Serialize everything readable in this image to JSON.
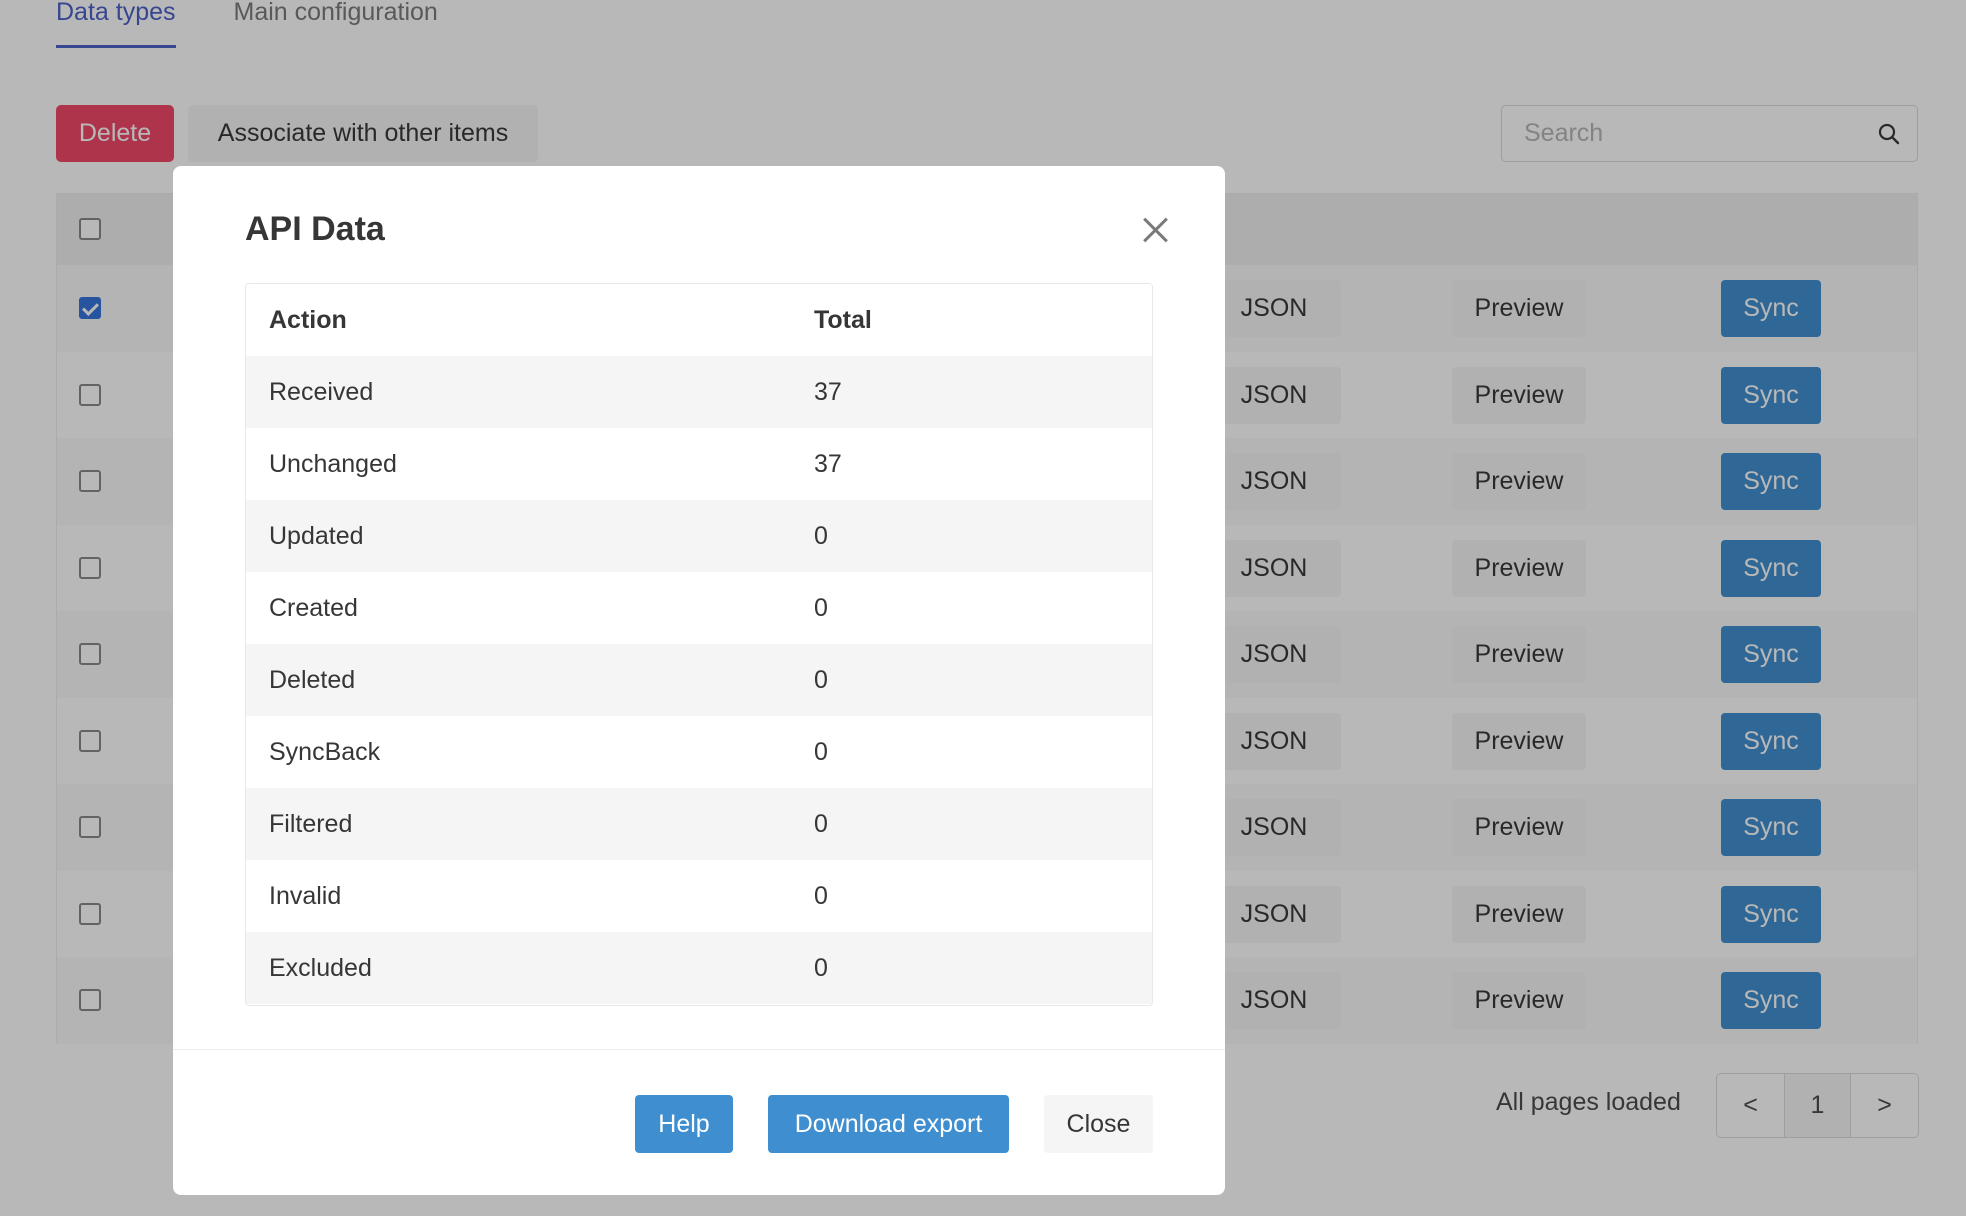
{
  "tabs": [
    {
      "label": "Data types",
      "active": true
    },
    {
      "label": "Main configuration",
      "active": false
    }
  ],
  "toolbar": {
    "delete_label": "Delete",
    "associate_label": "Associate with other items",
    "search_placeholder": "Search"
  },
  "table": {
    "rows": [
      {
        "checked": true,
        "json_label": "JSON",
        "preview_label": "Preview",
        "sync_label": "Sync"
      },
      {
        "checked": false,
        "json_label": "JSON",
        "preview_label": "Preview",
        "sync_label": "Sync"
      },
      {
        "checked": false,
        "json_label": "JSON",
        "preview_label": "Preview",
        "sync_label": "Sync"
      },
      {
        "checked": false,
        "json_label": "JSON",
        "preview_label": "Preview",
        "sync_label": "Sync"
      },
      {
        "checked": false,
        "json_label": "JSON",
        "preview_label": "Preview",
        "sync_label": "Sync"
      },
      {
        "checked": false,
        "json_label": "JSON",
        "preview_label": "Preview",
        "sync_label": "Sync"
      },
      {
        "checked": false,
        "json_label": "JSON",
        "preview_label": "Preview",
        "sync_label": "Sync"
      },
      {
        "checked": false,
        "json_label": "JSON",
        "preview_label": "Preview",
        "sync_label": "Sync"
      },
      {
        "checked": false,
        "json_label": "JSON",
        "preview_label": "Preview",
        "sync_label": "Sync"
      }
    ]
  },
  "footer": {
    "status": "All pages loaded",
    "prev_label": "<",
    "page": "1",
    "next_label": ">"
  },
  "modal": {
    "title": "API Data",
    "columns": [
      "Action",
      "Total"
    ],
    "rows": [
      {
        "action": "Received",
        "total": "37"
      },
      {
        "action": "Unchanged",
        "total": "37"
      },
      {
        "action": "Updated",
        "total": "0"
      },
      {
        "action": "Created",
        "total": "0"
      },
      {
        "action": "Deleted",
        "total": "0"
      },
      {
        "action": "SyncBack",
        "total": "0"
      },
      {
        "action": "Filtered",
        "total": "0"
      },
      {
        "action": "Invalid",
        "total": "0"
      },
      {
        "action": "Excluded",
        "total": "0"
      }
    ],
    "help_label": "Help",
    "download_label": "Download export",
    "close_label": "Close"
  }
}
